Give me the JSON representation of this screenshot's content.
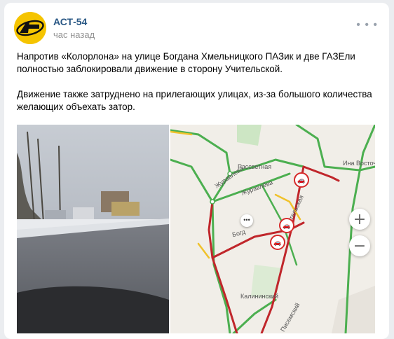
{
  "post": {
    "author": "АСТ-54",
    "time": "час назад",
    "paragraphs": [
      "Напротив «Колорлона» на улице Богдана Хмельницкого ПАЗик и две ГАЗЕли полностью заблокировали движение в сторону Учительской.",
      "Движение также затруднено на прилегающих улицах, из-за большого количества желающих объехать затор."
    ]
  },
  "map": {
    "street_labels": [
      "Рассветная",
      "Журавлева",
      "Журавлёва",
      "Ина Восточная",
      "Учительская",
      "Калининский",
      "Писемский",
      "Богд"
    ],
    "zoom_in": "+",
    "zoom_out": "−"
  },
  "icons": [
    "more-icon",
    "chat-icon",
    "traffic-accident-icon"
  ],
  "colors": {
    "link": "#2a5885",
    "avatar": "#f5c400",
    "jam_red": "#c0262b",
    "free_green": "#4caf50",
    "slow_yellow": "#f0c22b"
  }
}
